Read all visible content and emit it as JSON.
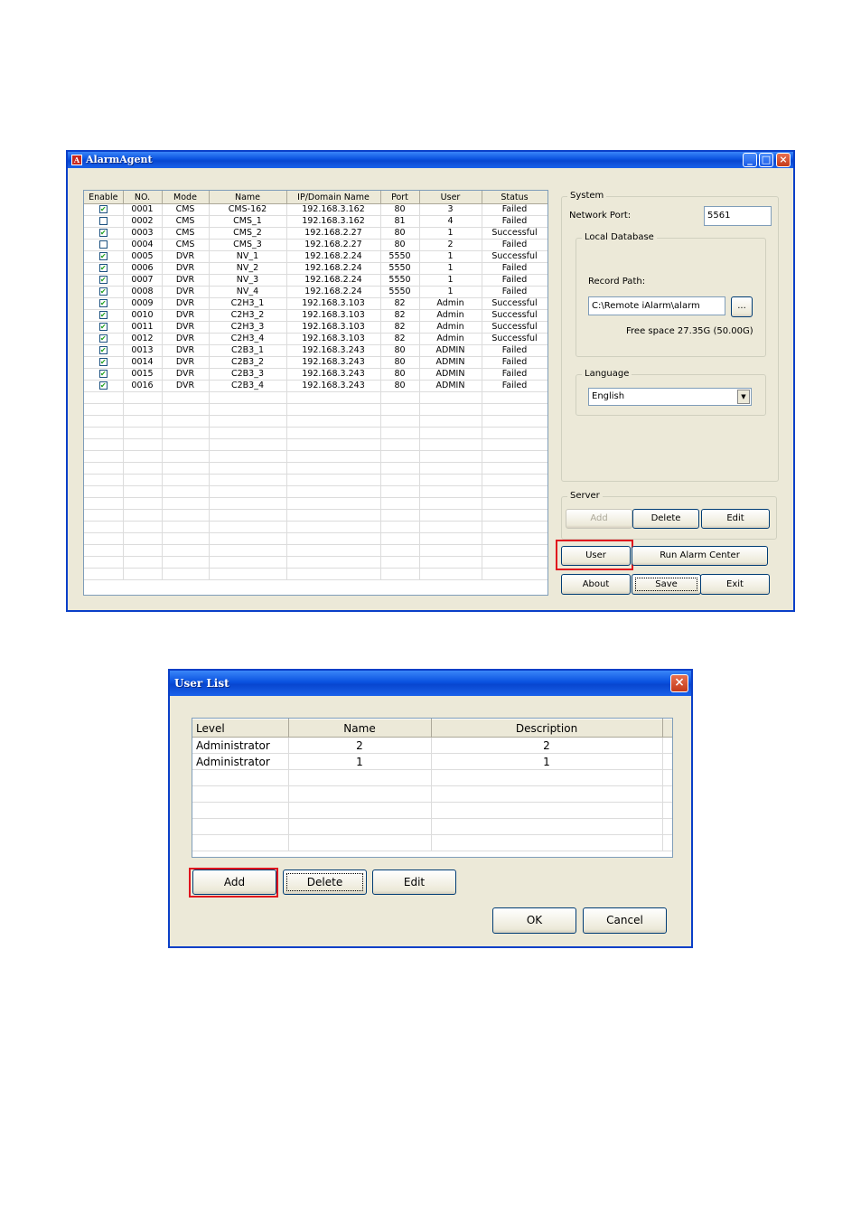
{
  "alarm_window": {
    "title": "AlarmAgent",
    "columns": [
      "Enable",
      "NO.",
      "Mode",
      "Name",
      "IP/Domain Name",
      "Port",
      "User",
      "Status"
    ],
    "rows": [
      {
        "enabled": true,
        "no": "0001",
        "mode": "CMS",
        "name": "CMS-162",
        "ip": "192.168.3.162",
        "port": "80",
        "user": "3",
        "status": "Failed"
      },
      {
        "enabled": false,
        "no": "0002",
        "mode": "CMS",
        "name": "CMS_1",
        "ip": "192.168.3.162",
        "port": "81",
        "user": "4",
        "status": "Failed"
      },
      {
        "enabled": true,
        "no": "0003",
        "mode": "CMS",
        "name": "CMS_2",
        "ip": "192.168.2.27",
        "port": "80",
        "user": "1",
        "status": "Successful"
      },
      {
        "enabled": false,
        "no": "0004",
        "mode": "CMS",
        "name": "CMS_3",
        "ip": "192.168.2.27",
        "port": "80",
        "user": "2",
        "status": "Failed"
      },
      {
        "enabled": true,
        "no": "0005",
        "mode": "DVR",
        "name": "NV_1",
        "ip": "192.168.2.24",
        "port": "5550",
        "user": "1",
        "status": "Successful"
      },
      {
        "enabled": true,
        "no": "0006",
        "mode": "DVR",
        "name": "NV_2",
        "ip": "192.168.2.24",
        "port": "5550",
        "user": "1",
        "status": "Failed"
      },
      {
        "enabled": true,
        "no": "0007",
        "mode": "DVR",
        "name": "NV_3",
        "ip": "192.168.2.24",
        "port": "5550",
        "user": "1",
        "status": "Failed"
      },
      {
        "enabled": true,
        "no": "0008",
        "mode": "DVR",
        "name": "NV_4",
        "ip": "192.168.2.24",
        "port": "5550",
        "user": "1",
        "status": "Failed"
      },
      {
        "enabled": true,
        "no": "0009",
        "mode": "DVR",
        "name": "C2H3_1",
        "ip": "192.168.3.103",
        "port": "82",
        "user": "Admin",
        "status": "Successful"
      },
      {
        "enabled": true,
        "no": "0010",
        "mode": "DVR",
        "name": "C2H3_2",
        "ip": "192.168.3.103",
        "port": "82",
        "user": "Admin",
        "status": "Successful"
      },
      {
        "enabled": true,
        "no": "0011",
        "mode": "DVR",
        "name": "C2H3_3",
        "ip": "192.168.3.103",
        "port": "82",
        "user": "Admin",
        "status": "Successful"
      },
      {
        "enabled": true,
        "no": "0012",
        "mode": "DVR",
        "name": "C2H3_4",
        "ip": "192.168.3.103",
        "port": "82",
        "user": "Admin",
        "status": "Successful"
      },
      {
        "enabled": true,
        "no": "0013",
        "mode": "DVR",
        "name": "C2B3_1",
        "ip": "192.168.3.243",
        "port": "80",
        "user": "ADMIN",
        "status": "Failed"
      },
      {
        "enabled": true,
        "no": "0014",
        "mode": "DVR",
        "name": "C2B3_2",
        "ip": "192.168.3.243",
        "port": "80",
        "user": "ADMIN",
        "status": "Failed"
      },
      {
        "enabled": true,
        "no": "0015",
        "mode": "DVR",
        "name": "C2B3_3",
        "ip": "192.168.3.243",
        "port": "80",
        "user": "ADMIN",
        "status": "Failed"
      },
      {
        "enabled": true,
        "no": "0016",
        "mode": "DVR",
        "name": "C2B3_4",
        "ip": "192.168.3.243",
        "port": "80",
        "user": "ADMIN",
        "status": "Failed"
      }
    ],
    "system": {
      "label": "System",
      "network_port_label": "Network Port:",
      "network_port_value": "5561",
      "local_db_label": "Local Database",
      "record_path_label": "Record Path:",
      "record_path_value": "C:\\Remote iAlarm\\alarm",
      "browse_label": "...",
      "free_space": "Free space 27.35G (50.00G)",
      "language_label": "Language",
      "language_value": "English"
    },
    "server": {
      "label": "Server",
      "add": "Add",
      "delete": "Delete",
      "edit": "Edit"
    },
    "buttons": {
      "user": "User",
      "run_alarm_center": "Run Alarm Center",
      "about": "About",
      "save": "Save",
      "exit": "Exit"
    }
  },
  "user_list": {
    "title": "User List",
    "columns": [
      "Level",
      "Name",
      "Description"
    ],
    "rows": [
      {
        "level": "Administrator",
        "name": "2",
        "description": "2"
      },
      {
        "level": "Administrator",
        "name": "1",
        "description": "1"
      }
    ],
    "buttons": {
      "add": "Add",
      "delete": "Delete",
      "edit": "Edit",
      "ok": "OK",
      "cancel": "Cancel"
    }
  },
  "colors": {
    "highlight": "#e0141e",
    "title_bar": "#0a52e0",
    "window_bg": "#ece9d8"
  }
}
